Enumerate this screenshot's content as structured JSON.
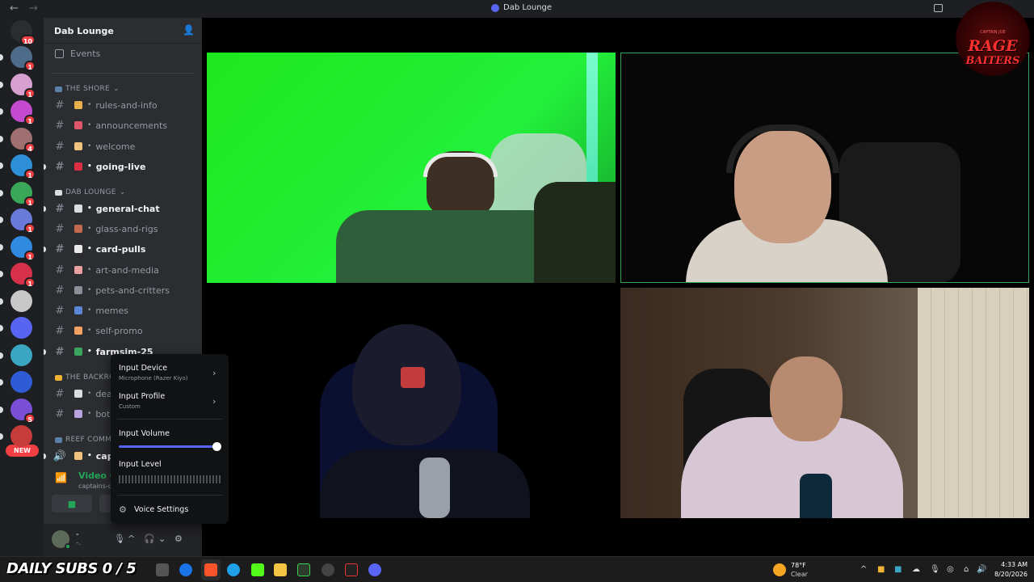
{
  "window": {
    "title": "Dab Lounge",
    "back_glyph": "←",
    "forward_glyph": "→"
  },
  "rail": {
    "home_badge": "10",
    "badges": [
      "1",
      "1",
      "1",
      "4",
      "1",
      "1",
      "1",
      "1",
      "1",
      "5"
    ],
    "new_label": "NEW",
    "colors": [
      "#4e6b8a",
      "#d7a0d0",
      "#c44bd0",
      "#a06f6f",
      "#2d8fd5",
      "#3aa858",
      "#6a7ad9",
      "#2f8ae0",
      "#d6304a",
      "#c8c8c8",
      "#5865f2",
      "#3aa6c2",
      "#2f5bd6",
      "#7a4fd6",
      "#c73b3b"
    ]
  },
  "sidebar": {
    "server_name": "Dab Lounge",
    "events_label": "Events",
    "categories": [
      {
        "label": "THE SHORE",
        "chevron": "⌄"
      },
      {
        "label": "DAB LOUNGE",
        "chevron": "⌄"
      },
      {
        "label": "THE BACKRO"
      },
      {
        "label": "REEF COMMS"
      }
    ],
    "channels": [
      {
        "name": "rules-and-info",
        "color": "#e8b04a",
        "unread": false
      },
      {
        "name": "announcements",
        "color": "#e0566a",
        "unread": false
      },
      {
        "name": "welcome",
        "color": "#f1c27d",
        "unread": false
      },
      {
        "name": "going-live",
        "color": "#dd2e44",
        "unread": true
      },
      {
        "name": "general-chat",
        "color": "#dbdee1",
        "unread": true
      },
      {
        "name": "glass-and-rigs",
        "color": "#c1694f",
        "unread": false
      },
      {
        "name": "card-pulls",
        "color": "#e8e8e8",
        "unread": true
      },
      {
        "name": "art-and-media",
        "color": "#e8a0a0",
        "unread": false
      },
      {
        "name": "pets-and-critters",
        "color": "#8a8f98",
        "unread": false
      },
      {
        "name": "memes",
        "color": "#5b86d6",
        "unread": false
      },
      {
        "name": "self-promo",
        "color": "#f4a261",
        "unread": false
      },
      {
        "name": "farmsim-25",
        "color": "#3ba55d",
        "unread": true
      },
      {
        "name": "dead",
        "color": "#dbdee1",
        "unread": false
      },
      {
        "name": "bot-c",
        "color": "#b9a4e0",
        "unread": false
      },
      {
        "name": "capta",
        "color": "#f1c27d",
        "unread": true
      }
    ],
    "voice": {
      "status": "Video Connected",
      "location": "captains-quarters / D"
    },
    "user": {
      "name": "-",
      "status": "-."
    }
  },
  "popup": {
    "input_device_title": "Input Device",
    "input_device_value": "Microphone (Razer Kiyo)",
    "input_profile_title": "Input Profile",
    "input_profile_value": "Custom",
    "input_volume_title": "Input Volume",
    "input_volume_level": 1.0,
    "input_level_title": "Input Level",
    "voice_settings_label": "Voice Settings"
  },
  "overlay_logo": {
    "top": "CAPTAIN JOE",
    "line1": "RAGE",
    "line2": "BAITERS"
  },
  "taskbar": {
    "subs_label": "DAILY SUBS 0 / 5",
    "weather_temp": "78°F",
    "weather_cond": "Clear",
    "time": "4:33 AM",
    "date": "8/20/2026"
  }
}
